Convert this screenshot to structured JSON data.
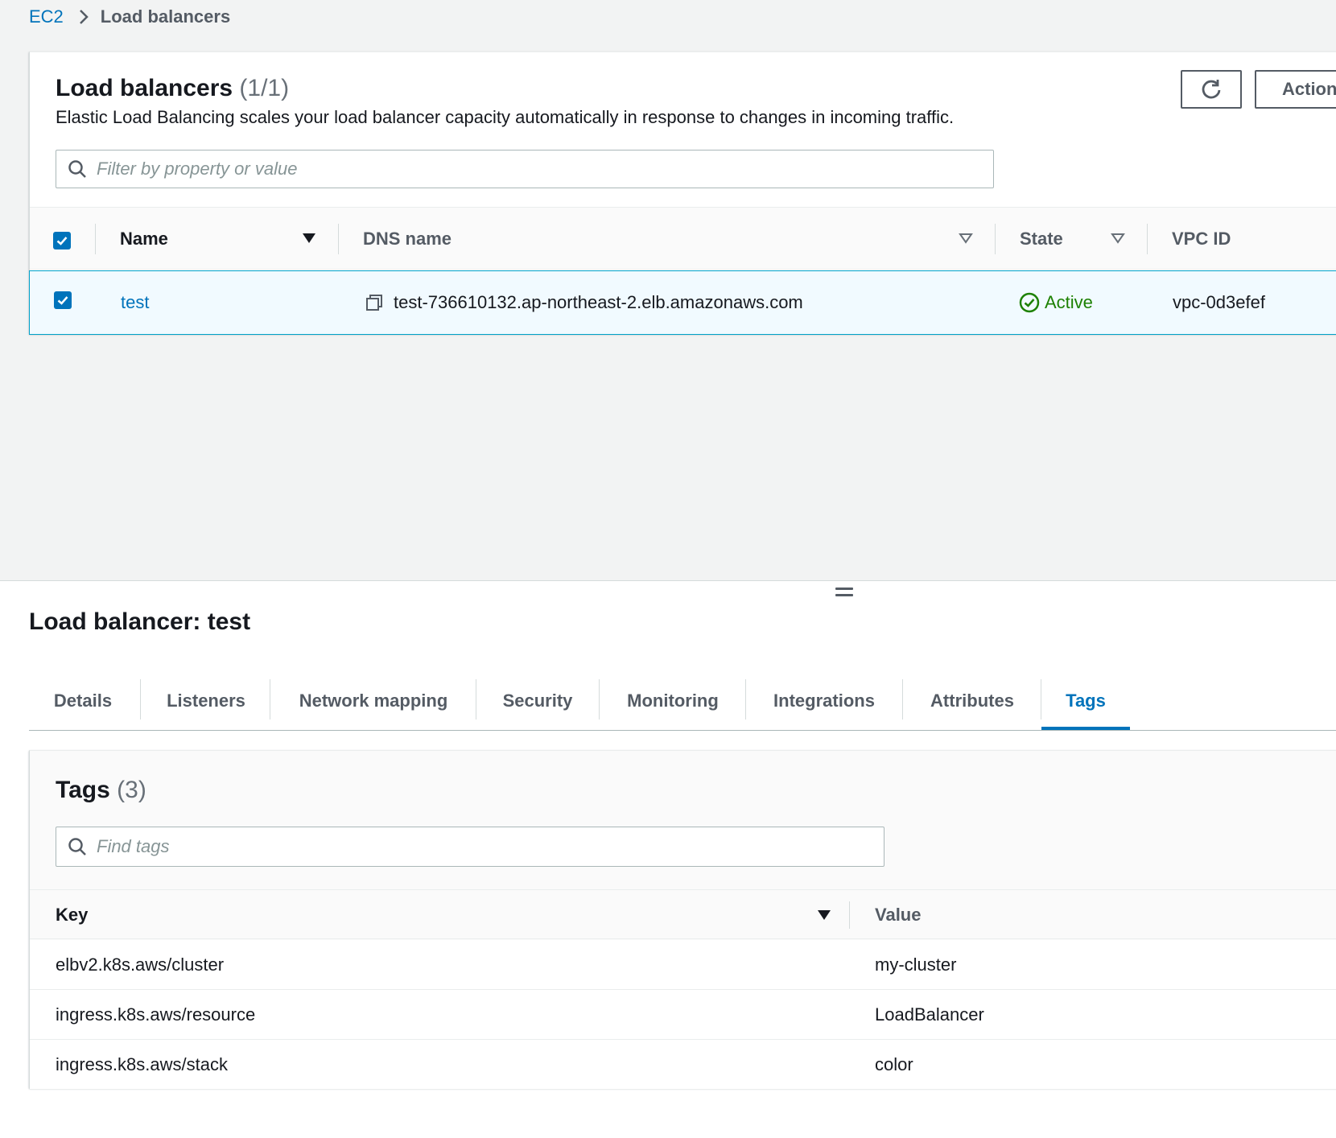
{
  "breadcrumb": {
    "root": "EC2",
    "current": "Load balancers"
  },
  "lb_panel": {
    "title": "Load balancers",
    "count": "(1/1)",
    "description": "Elastic Load Balancing scales your load balancer capacity automatically in response to changes in incoming traffic.",
    "actions_label": "Action",
    "search_placeholder": "Filter by property or value",
    "columns": {
      "name": "Name",
      "dns": "DNS name",
      "state": "State",
      "vpc": "VPC ID"
    },
    "row": {
      "name": "test",
      "dns": "test-736610132.ap-northeast-2.elb.amazonaws.com",
      "state": "Active",
      "vpc": "vpc-0d3efef"
    }
  },
  "detail": {
    "title": "Load balancer: test",
    "tabs": [
      "Details",
      "Listeners",
      "Network mapping",
      "Security",
      "Monitoring",
      "Integrations",
      "Attributes",
      "Tags"
    ],
    "active_tab": "Tags"
  },
  "tags": {
    "title": "Tags",
    "count": "(3)",
    "search_placeholder": "Find tags",
    "columns": {
      "key": "Key",
      "value": "Value"
    },
    "rows": [
      {
        "key": "elbv2.k8s.aws/cluster",
        "value": "my-cluster"
      },
      {
        "key": "ingress.k8s.aws/resource",
        "value": "LoadBalancer"
      },
      {
        "key": "ingress.k8s.aws/stack",
        "value": "color"
      }
    ]
  },
  "colors": {
    "link": "#0073bb",
    "active_state": "#1d8102",
    "background": "#f2f3f3"
  }
}
